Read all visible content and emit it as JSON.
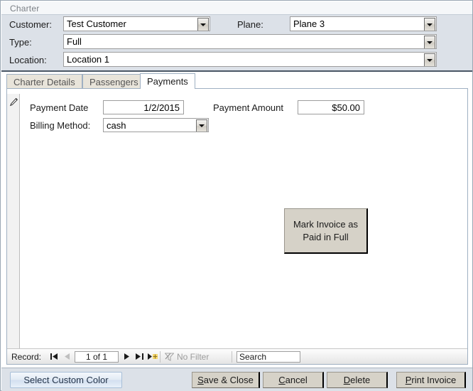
{
  "window": {
    "title": "Charter"
  },
  "header": {
    "fields": [
      {
        "label": "Customer:",
        "value": "Test Customer",
        "control": "combobox"
      },
      {
        "label": "Plane:",
        "value": "Plane 3",
        "control": "combobox"
      },
      {
        "label": "Type:",
        "value": "Full",
        "control": "combobox"
      },
      {
        "label": "Location:",
        "value": "Location 1",
        "control": "combobox"
      }
    ]
  },
  "tabs": [
    {
      "label": "Charter Details",
      "active": false
    },
    {
      "label": "Passengers",
      "active": false
    },
    {
      "label": "Payments",
      "active": true
    }
  ],
  "payments_tab": {
    "record_selector_icon": "pencil-edit-icon",
    "payment_date": {
      "label": "Payment Date",
      "value": "1/2/2015"
    },
    "payment_amount": {
      "label": "Payment Amount",
      "value": "$50.00"
    },
    "billing_method": {
      "label": "Billing Method:",
      "value": "cash"
    },
    "mark_paid_button": {
      "line1": "Mark Invoice as",
      "line2": "Paid in Full"
    }
  },
  "navbar": {
    "label": "Record:",
    "first_icon": "▌◀",
    "prev_icon": "◀",
    "position": "1 of 1",
    "next_icon": "▶",
    "last_icon": "▶▐",
    "new_icon": "▶✱",
    "filter_icon": "funnel-icon",
    "filter_label": "No Filter",
    "search_placeholder": "Search",
    "search_value": "Search"
  },
  "commandbar": {
    "custom_color": "Select Custom Color",
    "save_close_acc": "S",
    "save_close_rest": "ave & Close",
    "cancel_acc": "C",
    "cancel_rest": "ancel",
    "delete_acc": "D",
    "delete_rest": "elete",
    "print_acc": "P",
    "print_rest": "rint Invoice"
  },
  "colors": {
    "header_bg": "#dce1e8",
    "button_face": "#d6d2c8",
    "tab_inactive": "#e8e4da",
    "accent_border": "#4a5765"
  }
}
